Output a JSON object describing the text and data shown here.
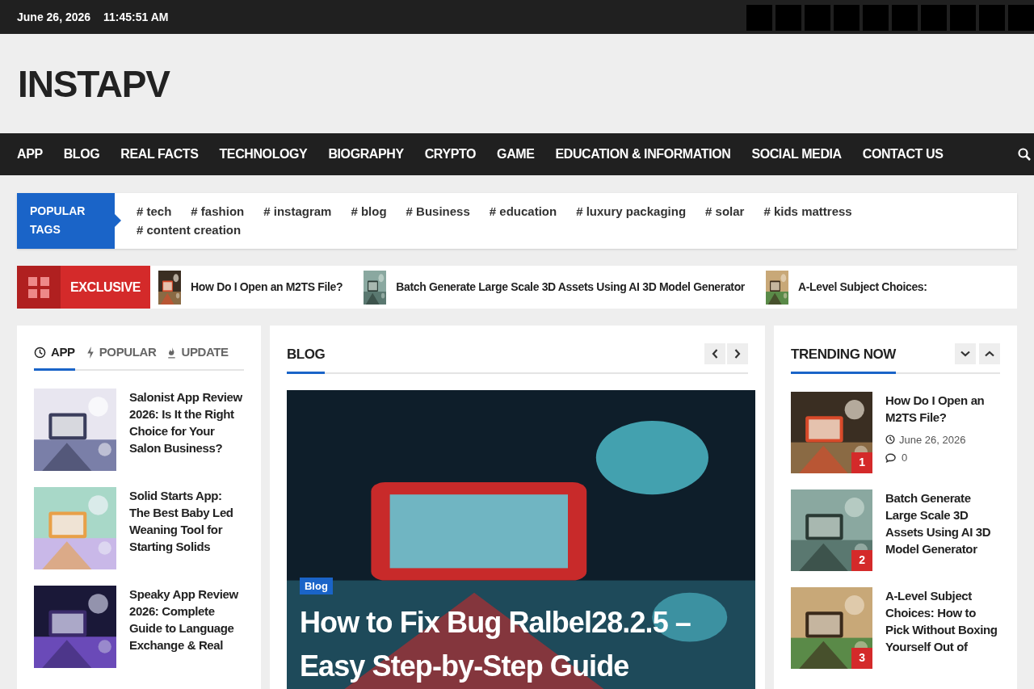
{
  "top_bar": {
    "date": "June 26, 2026",
    "time": "11:45:51 AM",
    "social_links": [
      {
        "kind": "square"
      },
      {
        "kind": "square"
      },
      {
        "kind": "square"
      },
      {
        "kind": "square"
      },
      {
        "kind": "square"
      },
      {
        "kind": "square"
      },
      {
        "kind": "square"
      },
      {
        "kind": "square"
      },
      {
        "kind": "square"
      },
      {
        "kind": "square"
      }
    ]
  },
  "site_title": "INSTAPV",
  "nav": {
    "items": [
      "APP",
      "BLOG",
      "REAL FACTS",
      "TECHNOLOGY",
      "BIOGRAPHY",
      "CRYPTO",
      "GAME",
      "EDUCATION & INFORMATION",
      "SOCIAL MEDIA",
      "CONTACT US"
    ]
  },
  "popular_tags": {
    "label": "POPULAR TAGS",
    "tags": [
      "# tech",
      "# fashion",
      "# instagram",
      "# blog",
      "# Business",
      "# education",
      "# luxury packaging",
      "# solar",
      "# kids mattress",
      "# content creation"
    ]
  },
  "exclusive": {
    "label": "EXCLUSIVE",
    "items": [
      {
        "title": "How Do I Open an M2TS File?"
      },
      {
        "title": "Batch Generate Large Scale 3D Assets Using AI 3D Model Generator"
      },
      {
        "title": "A-Level Subject Choices:"
      }
    ]
  },
  "tabs": [
    {
      "kind": "clock",
      "label": "APP",
      "selected": true
    },
    {
      "kind": "bolt",
      "label": "POPULAR",
      "selected": false
    },
    {
      "kind": "flame",
      "label": "UPDATE",
      "selected": false
    }
  ],
  "app_posts": [
    {
      "title": "Salonist App Review 2026: Is It the Right Choice for Your Salon Business?"
    },
    {
      "title": "Solid Starts App: The Best Baby Led Weaning Tool for Starting Solids"
    },
    {
      "title": "Speaky App Review 2026: Complete Guide to Language Exchange & Real"
    }
  ],
  "blog": {
    "title": "BLOG",
    "featured": {
      "category": "Blog",
      "title": "How to Fix Bug Ralbel28.2.5 – Easy Step-by-Step Guide"
    }
  },
  "trending": {
    "title": "TRENDING NOW",
    "items": [
      {
        "rank": "1",
        "title": "How Do I Open an M2TS File?",
        "date": "June 26, 2026",
        "comments": "0"
      },
      {
        "rank": "2",
        "title": "Batch Generate Large Scale 3D Assets Using AI 3D Model Generator"
      },
      {
        "rank": "3",
        "title": "A-Level Subject Choices: How to Pick Without Boxing Yourself Out of"
      }
    ]
  }
}
